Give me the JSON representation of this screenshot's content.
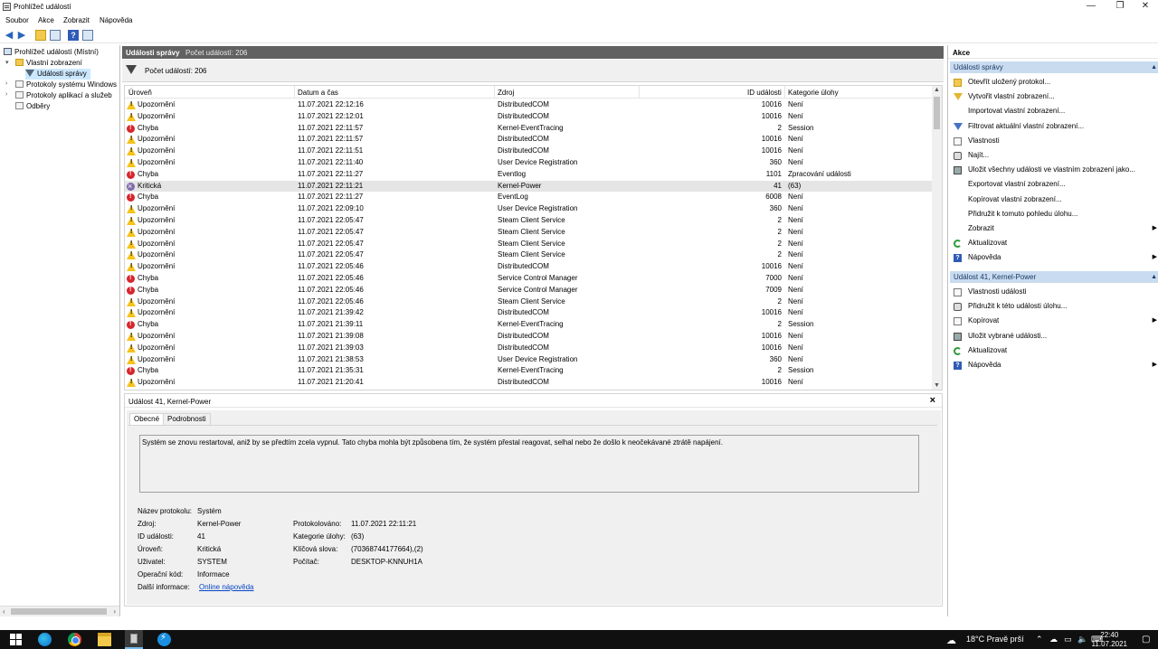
{
  "window": {
    "title": "Prohlížeč událostí",
    "controls": {
      "minimize": "—",
      "maximize": "❐",
      "close": "✕"
    }
  },
  "menu": [
    "Soubor",
    "Akce",
    "Zobrazit",
    "Nápověda"
  ],
  "tree": {
    "root": "Prohlížeč událostí (Místní)",
    "custom_views": "Vlastní zobrazení",
    "admin_events": "Události správy",
    "windows_logs": "Protokoly systému Windows",
    "app_logs": "Protokoly aplikací a služeb",
    "subscriptions": "Odběry"
  },
  "center": {
    "header_title": "Události správy",
    "header_count": "Počet událostí: 206",
    "filter_text": "Počet událostí: 206",
    "columns": [
      "Úroveň",
      "Datum a čas",
      "Zdroj",
      "ID události",
      "Kategorie úlohy"
    ],
    "rows": [
      {
        "level": "Upozornění",
        "type": "warn",
        "date": "11.07.2021 22:12:16",
        "source": "DistributedCOM",
        "id": "10016",
        "category": "Není"
      },
      {
        "level": "Upozornění",
        "type": "warn",
        "date": "11.07.2021 22:12:01",
        "source": "DistributedCOM",
        "id": "10016",
        "category": "Není"
      },
      {
        "level": "Chyba",
        "type": "err",
        "date": "11.07.2021 22:11:57",
        "source": "Kernel-EventTracing",
        "id": "2",
        "category": "Session"
      },
      {
        "level": "Upozornění",
        "type": "warn",
        "date": "11.07.2021 22:11:57",
        "source": "DistributedCOM",
        "id": "10016",
        "category": "Není"
      },
      {
        "level": "Upozornění",
        "type": "warn",
        "date": "11.07.2021 22:11:51",
        "source": "DistributedCOM",
        "id": "10016",
        "category": "Není"
      },
      {
        "level": "Upozornění",
        "type": "warn",
        "date": "11.07.2021 22:11:40",
        "source": "User Device Registration",
        "id": "360",
        "category": "Není"
      },
      {
        "level": "Chyba",
        "type": "err",
        "date": "11.07.2021 22:11:27",
        "source": "Eventlog",
        "id": "1101",
        "category": "Zpracování události"
      },
      {
        "level": "Kritická",
        "type": "crit",
        "date": "11.07.2021 22:11:21",
        "source": "Kernel-Power",
        "id": "41",
        "category": "(63)",
        "selected": true
      },
      {
        "level": "Chyba",
        "type": "err",
        "date": "11.07.2021 22:11:27",
        "source": "EventLog",
        "id": "6008",
        "category": "Není"
      },
      {
        "level": "Upozornění",
        "type": "warn",
        "date": "11.07.2021 22:09:10",
        "source": "User Device Registration",
        "id": "360",
        "category": "Není"
      },
      {
        "level": "Upozornění",
        "type": "warn",
        "date": "11.07.2021 22:05:47",
        "source": "Steam Client Service",
        "id": "2",
        "category": "Není"
      },
      {
        "level": "Upozornění",
        "type": "warn",
        "date": "11.07.2021 22:05:47",
        "source": "Steam Client Service",
        "id": "2",
        "category": "Není"
      },
      {
        "level": "Upozornění",
        "type": "warn",
        "date": "11.07.2021 22:05:47",
        "source": "Steam Client Service",
        "id": "2",
        "category": "Není"
      },
      {
        "level": "Upozornění",
        "type": "warn",
        "date": "11.07.2021 22:05:47",
        "source": "Steam Client Service",
        "id": "2",
        "category": "Není"
      },
      {
        "level": "Upozornění",
        "type": "warn",
        "date": "11.07.2021 22:05:46",
        "source": "DistributedCOM",
        "id": "10016",
        "category": "Není"
      },
      {
        "level": "Chyba",
        "type": "err",
        "date": "11.07.2021 22:05:46",
        "source": "Service Control Manager",
        "id": "7000",
        "category": "Není"
      },
      {
        "level": "Chyba",
        "type": "err",
        "date": "11.07.2021 22:05:46",
        "source": "Service Control Manager",
        "id": "7009",
        "category": "Není"
      },
      {
        "level": "Upozornění",
        "type": "warn",
        "date": "11.07.2021 22:05:46",
        "source": "Steam Client Service",
        "id": "2",
        "category": "Není"
      },
      {
        "level": "Upozornění",
        "type": "warn",
        "date": "11.07.2021 21:39:42",
        "source": "DistributedCOM",
        "id": "10016",
        "category": "Není"
      },
      {
        "level": "Chyba",
        "type": "err",
        "date": "11.07.2021 21:39:11",
        "source": "Kernel-EventTracing",
        "id": "2",
        "category": "Session"
      },
      {
        "level": "Upozornění",
        "type": "warn",
        "date": "11.07.2021 21:39:08",
        "source": "DistributedCOM",
        "id": "10016",
        "category": "Není"
      },
      {
        "level": "Upozornění",
        "type": "warn",
        "date": "11.07.2021 21:39:03",
        "source": "DistributedCOM",
        "id": "10016",
        "category": "Není"
      },
      {
        "level": "Upozornění",
        "type": "warn",
        "date": "11.07.2021 21:38:53",
        "source": "User Device Registration",
        "id": "360",
        "category": "Není"
      },
      {
        "level": "Chyba",
        "type": "err",
        "date": "11.07.2021 21:35:31",
        "source": "Kernel-EventTracing",
        "id": "2",
        "category": "Session"
      },
      {
        "level": "Upozornění",
        "type": "warn",
        "date": "11.07.2021 21:20:41",
        "source": "DistributedCOM",
        "id": "10016",
        "category": "Není"
      }
    ]
  },
  "detail": {
    "title": "Událost 41, Kernel-Power",
    "close": "×",
    "tabs": [
      "Obecné",
      "Podrobnosti"
    ],
    "description": "Systém se znovu restartoval, aniž by se předtím zcela vypnul. Tato chyba mohla být způsobena tím, že systém přestal reagovat, selhal nebo že došlo k neočekávané ztrátě napájení.",
    "props": {
      "log_name_label": "Název protokolu:",
      "log_name": "Systém",
      "source_label": "Zdroj:",
      "source": "Kernel-Power",
      "logged_label": "Protokolováno:",
      "logged": "11.07.2021 22:11:21",
      "id_label": "ID události:",
      "id": "41",
      "task_label": "Kategorie úlohy:",
      "task": "(63)",
      "level_label": "Úroveň:",
      "level": "Kritická",
      "keywords_label": "Klíčová slova:",
      "keywords": "(70368744177664),(2)",
      "user_label": "Uživatel:",
      "user": "SYSTEM",
      "computer_label": "Počítač:",
      "computer": "DESKTOP-KNNUH1A",
      "opcode_label": "Operační kód:",
      "opcode": "Informace",
      "more_label": "Další informace:",
      "more_link": "Online nápověda"
    }
  },
  "actions": {
    "title": "Akce",
    "section1": "Události správy",
    "items1": [
      {
        "label": "Otevřít uložený protokol...",
        "icon": "folder"
      },
      {
        "label": "Vytvořit vlastní zobrazení...",
        "icon": "filterY"
      },
      {
        "label": "Importovat vlastní zobrazení...",
        "icon": ""
      },
      {
        "label": "Filtrovat aktuální vlastní zobrazení...",
        "icon": "filter"
      },
      {
        "label": "Vlastnosti",
        "icon": "doc"
      },
      {
        "label": "Najít...",
        "icon": "find"
      },
      {
        "label": "Uložit všechny události ve vlastním zobrazení jako...",
        "icon": "save"
      },
      {
        "label": "Exportovat vlastní zobrazení...",
        "icon": ""
      },
      {
        "label": "Kopírovat vlastní zobrazení...",
        "icon": ""
      },
      {
        "label": "Přidružit k tomuto pohledu úlohu...",
        "icon": ""
      },
      {
        "label": "Zobrazit",
        "icon": "",
        "submenu": true
      },
      {
        "label": "Aktualizovat",
        "icon": "refresh"
      },
      {
        "label": "Nápověda",
        "icon": "help",
        "submenu": true
      }
    ],
    "section2": "Událost 41, Kernel-Power",
    "items2": [
      {
        "label": "Vlastnosti události",
        "icon": "doc"
      },
      {
        "label": "Přidružit k této události úlohu...",
        "icon": "find"
      },
      {
        "label": "Kopírovat",
        "icon": "doc",
        "submenu": true
      },
      {
        "label": "Uložit vybrané události...",
        "icon": "save"
      },
      {
        "label": "Aktualizovat",
        "icon": "refresh"
      },
      {
        "label": "Nápověda",
        "icon": "help",
        "submenu": true
      }
    ]
  },
  "taskbar": {
    "weather": "18°C  Pravě prší",
    "time": "22:40",
    "date": "11.07.2021"
  }
}
